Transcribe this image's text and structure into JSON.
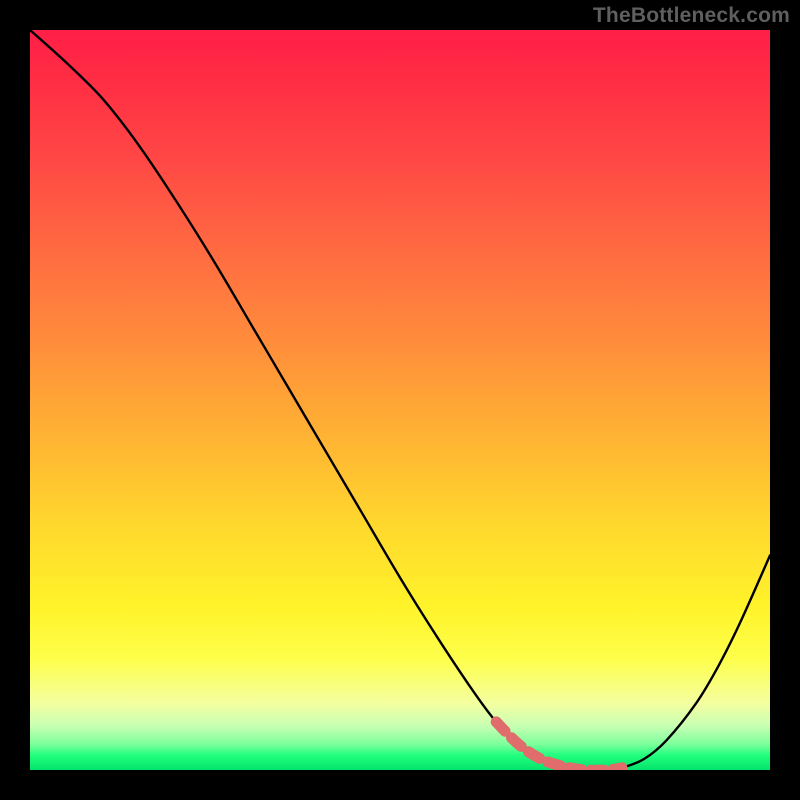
{
  "watermark": "TheBottleneck.com",
  "colors": {
    "background": "#000000",
    "watermark": "#5f5f5f",
    "curve_stroke": "#000000",
    "trough_stroke": "#e06c6c",
    "gradient_top": "#ff1f47",
    "gradient_bottom": "#04e46b"
  },
  "chart_data": {
    "type": "line",
    "title": "",
    "xlabel": "",
    "ylabel": "",
    "xlim": [
      0,
      100
    ],
    "ylim": [
      0,
      100
    ],
    "x": [
      0,
      5,
      10,
      15,
      20,
      25,
      30,
      35,
      40,
      45,
      50,
      55,
      60,
      63,
      66,
      69,
      72,
      75,
      78,
      80,
      83,
      86,
      90,
      93,
      96,
      100
    ],
    "y": [
      100,
      95.5,
      90.5,
      84,
      76.5,
      68.5,
      60,
      51.5,
      43,
      34.5,
      26,
      18,
      10.5,
      6.5,
      3.5,
      1.5,
      0.5,
      0,
      0,
      0.3,
      1.5,
      4,
      9,
      14,
      20,
      29
    ],
    "trough_range_x": [
      63,
      80
    ],
    "annotations": []
  }
}
